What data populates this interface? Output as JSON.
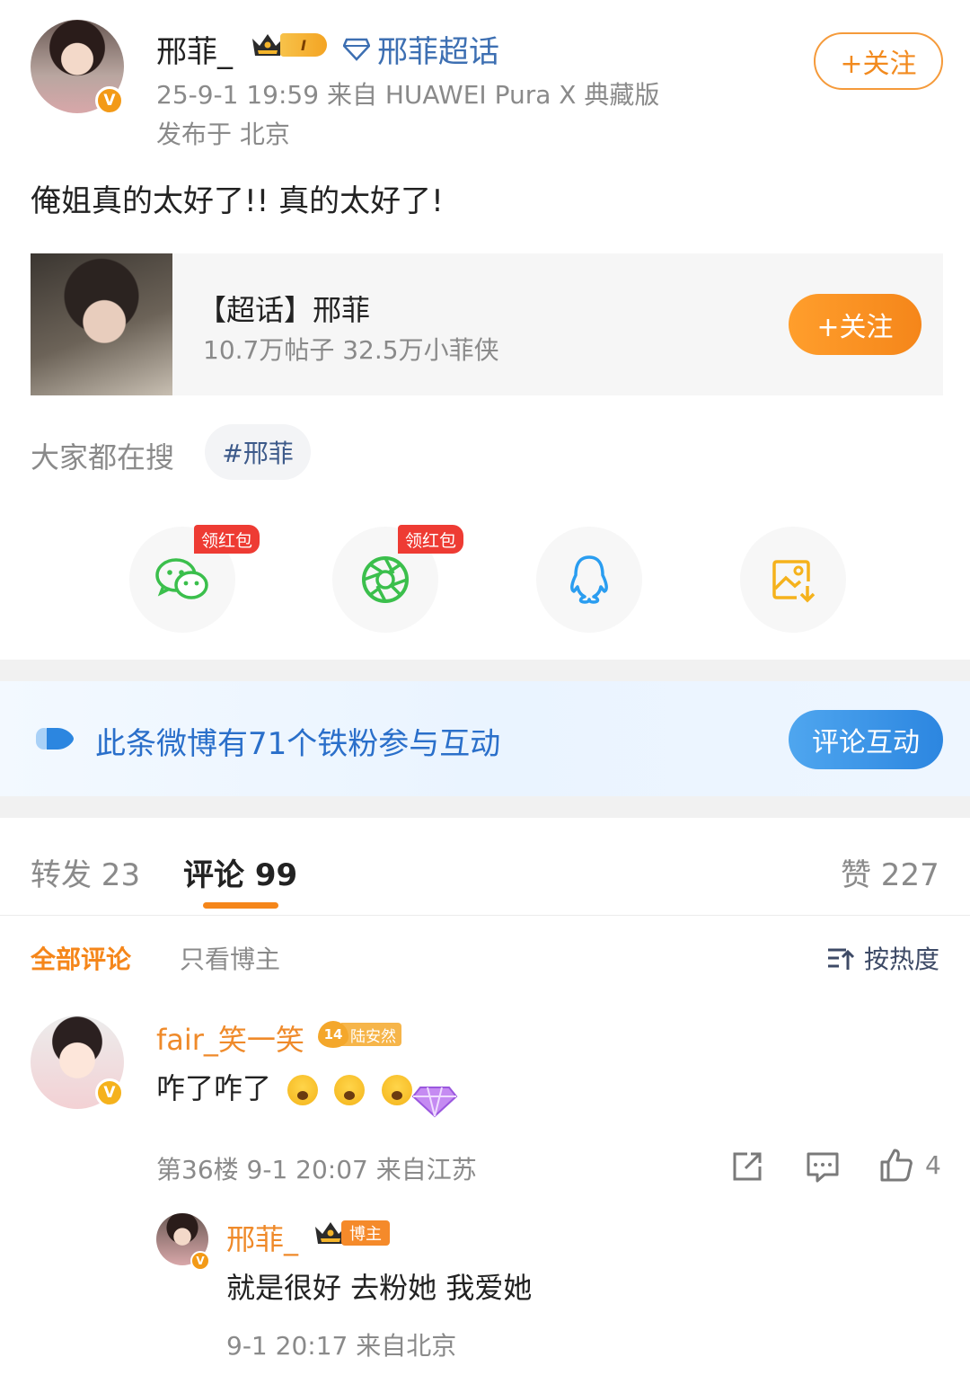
{
  "post": {
    "author": "邢菲_",
    "member_level": "I",
    "topic_link": "邢菲超话",
    "time_source": "25-9-1 19:59  来自 HUAWEI Pura X 典藏版",
    "location": "发布于 北京",
    "follow_label": "+关注",
    "text": "俺姐真的太好了!!  真的太好了!"
  },
  "supertopic_card": {
    "title": "【超话】邢菲",
    "stats": "10.7万帖子 32.5万小菲侠",
    "follow_label": "+关注"
  },
  "search": {
    "label": "大家都在搜",
    "tag": "#邢菲"
  },
  "share": {
    "redpack_label": "领红包",
    "items": [
      {
        "icon": "wechat-icon",
        "color": "#3bbf4c"
      },
      {
        "icon": "moments-icon",
        "color": "#3bbf4c"
      },
      {
        "icon": "qq-icon",
        "color": "#2a9df0"
      },
      {
        "icon": "save-image-icon",
        "color": "#f5b21c"
      }
    ]
  },
  "banner": {
    "text": "此条微博有71个铁粉参与互动",
    "button": "评论互动"
  },
  "tabs": {
    "repost": "转发 23",
    "comments": "评论 99",
    "likes": "赞 227"
  },
  "filters": {
    "all": "全部评论",
    "owner_only": "只看博主",
    "sort": "按热度"
  },
  "comment": {
    "name": "fair_笑一笑",
    "fan_level": "14",
    "fan_tag": "陆安然",
    "text": "咋了咋了",
    "meta": "第36楼 9-1 20:07  来自江苏",
    "like_count": "4"
  },
  "reply": {
    "name": "邢菲_",
    "owner_tag": "博主",
    "text": "就是很好 去粉她 我爱她",
    "meta": "9-1 20:17  来自北京"
  },
  "colors": {
    "accent_orange": "#f5861a",
    "link_blue": "#3d6fb2",
    "banner_blue": "#2a6fca",
    "redpack_red": "#ee3b33"
  }
}
